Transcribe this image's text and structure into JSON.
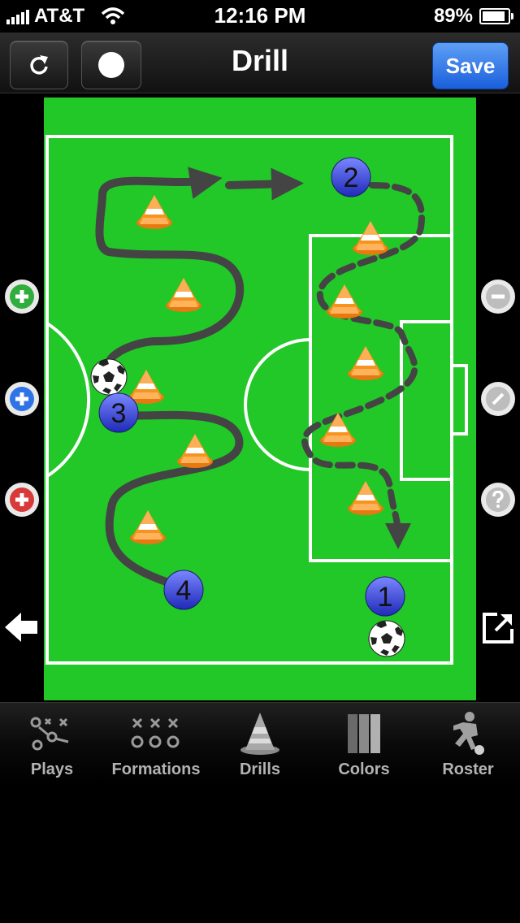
{
  "status_bar": {
    "carrier": "AT&T",
    "time": "12:16 PM",
    "battery": "89%",
    "battery_level": 0.89
  },
  "nav": {
    "title": "Drill",
    "save_label": "Save"
  },
  "field": {
    "players": [
      {
        "number": "2"
      },
      {
        "number": "3"
      },
      {
        "number": "4"
      },
      {
        "number": "1"
      }
    ]
  },
  "left_controls": [
    "add-player-green",
    "add-player-blue",
    "add-player-red",
    "back-arrow"
  ],
  "right_controls": [
    "remove-item",
    "draw-line",
    "help",
    "share"
  ],
  "tabs": [
    {
      "label": "Plays",
      "icon": "plays-icon"
    },
    {
      "label": "Formations",
      "icon": "formations-icon"
    },
    {
      "label": "Drills",
      "icon": "drills-cone-icon"
    },
    {
      "label": "Colors",
      "icon": "colors-icon"
    },
    {
      "label": "Roster",
      "icon": "roster-player-icon"
    }
  ],
  "colors": {
    "field_green": "#22c728",
    "save_blue": "#2f74e6",
    "player_blue": "#2a3ad8",
    "cone_orange": "#f7941d",
    "route_gray": "#444444"
  }
}
